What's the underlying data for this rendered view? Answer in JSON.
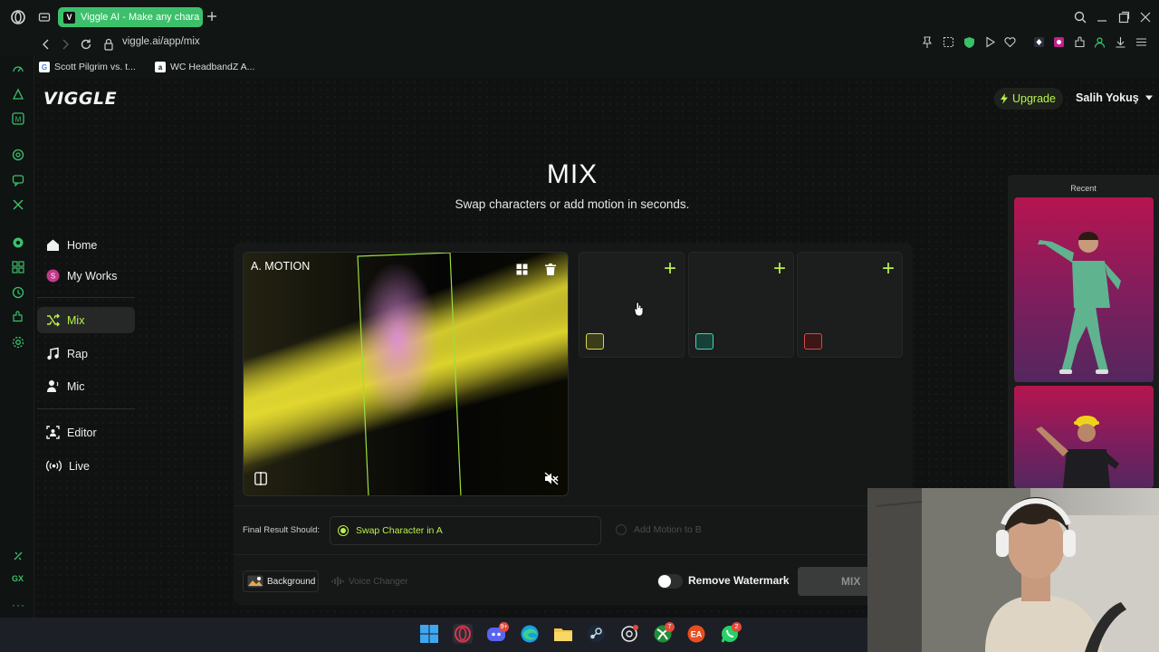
{
  "browser": {
    "tab_title": "Viggle AI - Make any chara",
    "tab_favicon": "V",
    "url": "viggle.ai/app/mix",
    "bookmarks": [
      {
        "label": "Scott Pilgrim vs. t...",
        "icon": "google-icon"
      },
      {
        "label": "WC HeadbandZ A...",
        "icon": "amazon-icon"
      }
    ]
  },
  "app": {
    "logo": "VIGGLE",
    "upgrade_label": "Upgrade",
    "user_name": "Salih Yokuş",
    "accent_color": "#b7f24a"
  },
  "nav": {
    "home": "Home",
    "my_works": "My Works",
    "mix": "Mix",
    "rap": "Rap",
    "mic": "Mic",
    "editor": "Editor",
    "live": "Live"
  },
  "page": {
    "title": "MIX",
    "subtitle": "Swap characters or add motion in seconds."
  },
  "mix": {
    "motion_label": "A. MOTION",
    "slot_plus": "+",
    "final_result_label": "Final Result Should:",
    "swap_option": "Swap Character in A",
    "add_motion_option": "Add Motion to B",
    "background_label": "Background",
    "voice_changer_label": "Voice Changer",
    "remove_watermark_label": "Remove Watermark",
    "mix_button": "MIX"
  },
  "recent": {
    "label": "Recent"
  },
  "taskbar": {
    "discord_badge": "9+",
    "xbox_badge": "7",
    "whatsapp_badge": "2"
  }
}
